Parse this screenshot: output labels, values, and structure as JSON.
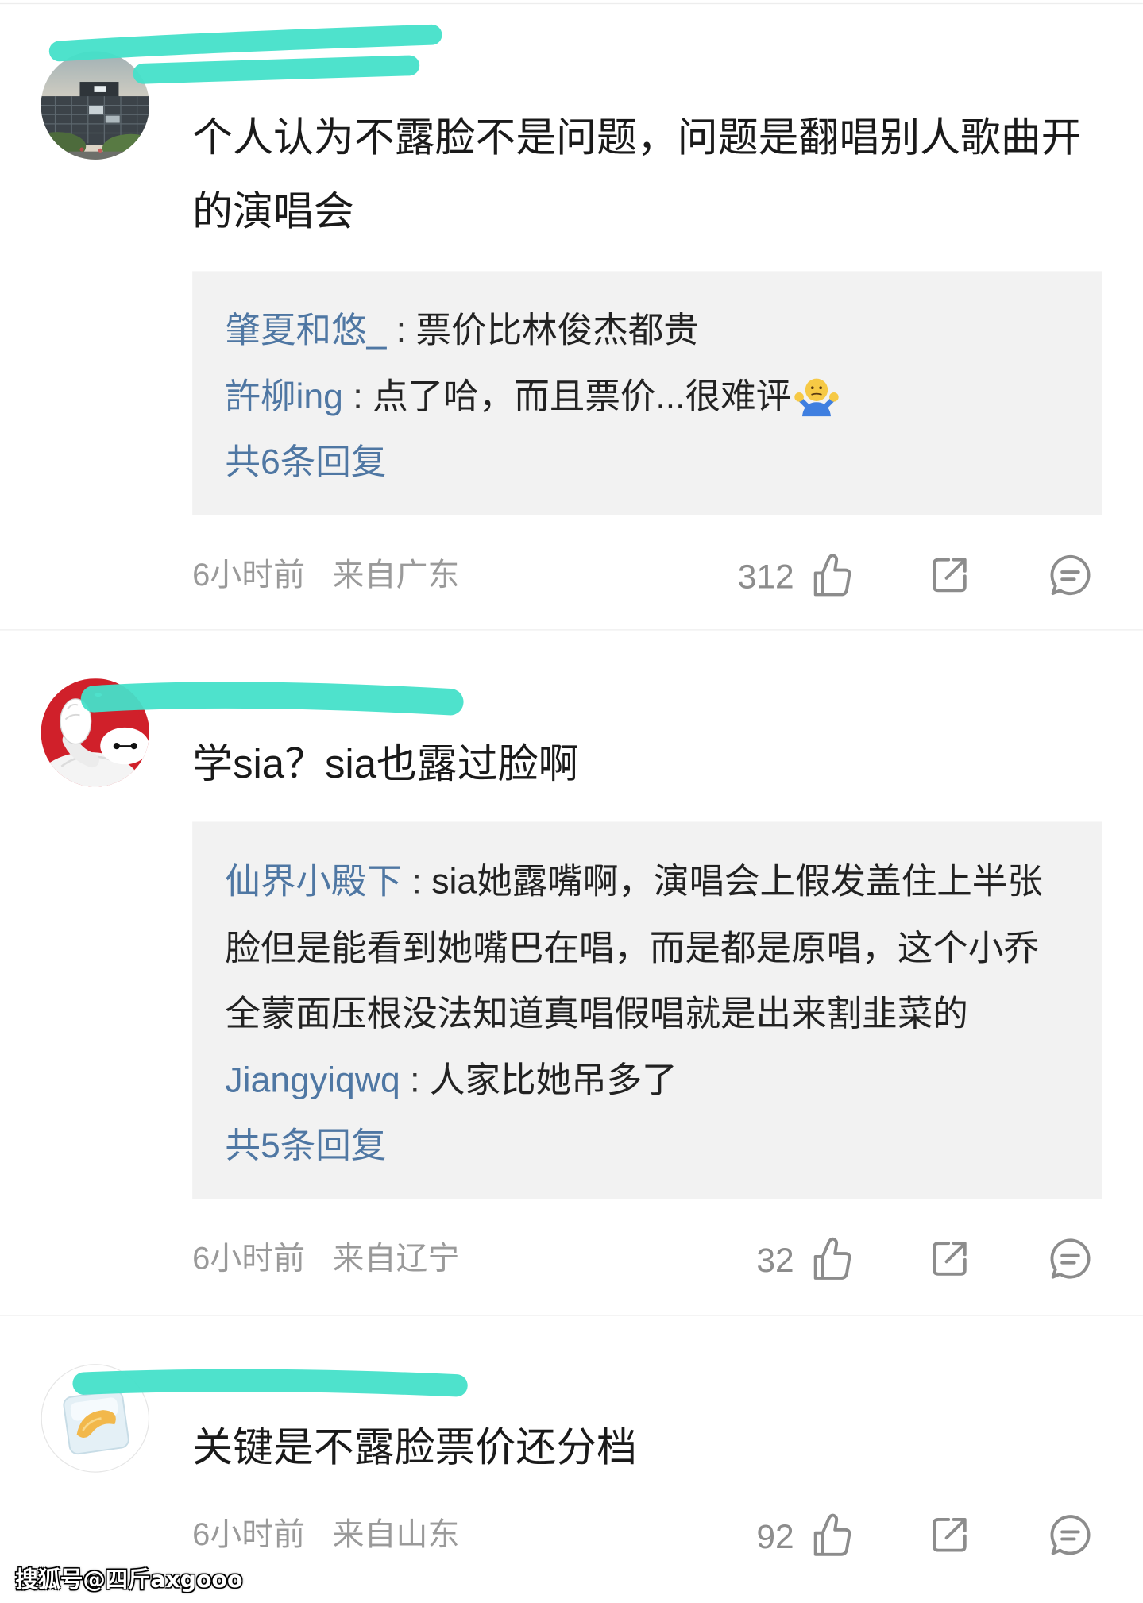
{
  "colors": {
    "text": "#1a1a1a",
    "link": "#4f77a3",
    "meta": "#9a9a9a",
    "reply_bg": "#f2f2f2",
    "icon": "#8c8c8c",
    "redaction": "#45e0c9"
  },
  "icons": {
    "like": "thumbs-up-icon",
    "share": "share-icon",
    "comment": "comment-icon",
    "emoji": "shrug-emoji"
  },
  "comments": [
    {
      "text": "个人认为不露脸不是问题，问题是翻唱别人歌曲开的演唱会",
      "replies": [
        {
          "user": "肇夏和悠_",
          "sep": " : ",
          "text": "票价比林俊杰都贵"
        },
        {
          "user": "許柳ing",
          "sep": " : ",
          "text": "点了哈，而且票价...很难评"
        }
      ],
      "more_replies": "共6条回复",
      "time": "6小时前",
      "location": "来自广东",
      "likes": "312"
    },
    {
      "text": "学sia？sia也露过脸啊",
      "replies": [
        {
          "user": "仙界小殿下",
          "sep": " : ",
          "text": "sia她露嘴啊，演唱会上假发盖住上半张脸但是能看到她嘴巴在唱，而是都是原唱，这个小乔全蒙面压根没法知道真唱假唱就是出来割韭菜的"
        },
        {
          "user": "Jiangyiqwq",
          "sep": " : ",
          "text": "人家比她吊多了"
        }
      ],
      "more_replies": "共5条回复",
      "time": "6小时前",
      "location": "来自辽宁",
      "likes": "32"
    },
    {
      "text": "关键是不露脸票价还分档",
      "time": "6小时前",
      "location": "来自山东",
      "likes": "92"
    }
  ],
  "watermark": "搜狐号@四斤axgooo"
}
